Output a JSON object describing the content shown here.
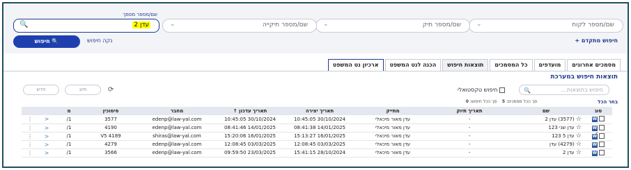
{
  "filters": {
    "client_placeholder": "שם/מספר לקוח",
    "case_placeholder": "שם/מספר תיק",
    "folder_placeholder": "שם/מספר תיקייה",
    "search_label": "שם/מספר מסמך",
    "search_value": "עדן 2"
  },
  "actions": {
    "search_button": "חיפוש",
    "clear_search": "נקה חיפוש",
    "advanced_search": "חיפוש מתקדם +"
  },
  "tabs": [
    "מסמכים אחרונים",
    "מועדפים",
    "כל המסמכים",
    "תוצאות חיפוש",
    "הכנה לנט המשפט",
    "ארכיון נט המשפט"
  ],
  "results": {
    "title": "תוצאות חיפוש במערכת",
    "search_placeholder": "חיפוש בתוצאות...",
    "textual_search": "חיפוש טקסטואלי",
    "tag_button": "תיוג",
    "new_button": "חדש",
    "select_all": "בחר הכל",
    "total_docs_label": "סך הכל מסמכים:",
    "total_docs": "5",
    "total_search_label": "סך הכל חיפוש:",
    "total_search": "0"
  },
  "table": {
    "headers": [
      "סוג",
      "שם",
      "תאריך תיוק",
      "מתייק",
      "תאריך יצירה",
      "תאריך עדכון ↑",
      "מחבר",
      "סימוכין",
      "מ"
    ],
    "rows": [
      {
        "name": "(3577) עדן 2",
        "filed": "-",
        "filer": "עדן מאור מיכאלי",
        "created": "30/10/2024 10:45:05",
        "updated": "30/10/2024 10:45:05",
        "author": "edenp@law-yal.com",
        "ref": "3577",
        "m": "1/"
      },
      {
        "name": "עדן שני 123",
        "filed": "-",
        "filer": "עדן מאור מיכאלי",
        "created": "14/01/2025 08:41:38",
        "updated": "14/01/2025 08:41:46",
        "author": "edenp@law-yal.com",
        "ref": "4190",
        "m": "1/"
      },
      {
        "name": "עדן 5 123",
        "filed": "-",
        "filer": "עדן מאור מיכאלי",
        "created": "16/01/2025 15:13:27",
        "updated": "16/01/2025 15:20:06",
        "author": "shiras@law-yal.com",
        "ref": "V5 4189",
        "m": "1/"
      },
      {
        "name": "(4279) עדן",
        "filed": "-",
        "filer": "עדן מאור מיכאלי",
        "created": "03/03/2025 12:08:45",
        "updated": "03/03/2025 12:08:45",
        "author": "edenp@law-yal.com",
        "ref": "4279",
        "m": "1/"
      },
      {
        "name": "עדן 2",
        "filed": "-",
        "filer": "עדן מאור מיכאלי",
        "created": "28/10/2024 15:41:15",
        "updated": "23/03/2025 09:59:50",
        "author": "edenp@law-yal.com",
        "ref": "3566",
        "m": "1/"
      }
    ]
  },
  "colors": {
    "accent": "#1e40af",
    "frame": "#1f4e5f",
    "highlight": "#ffff00"
  }
}
